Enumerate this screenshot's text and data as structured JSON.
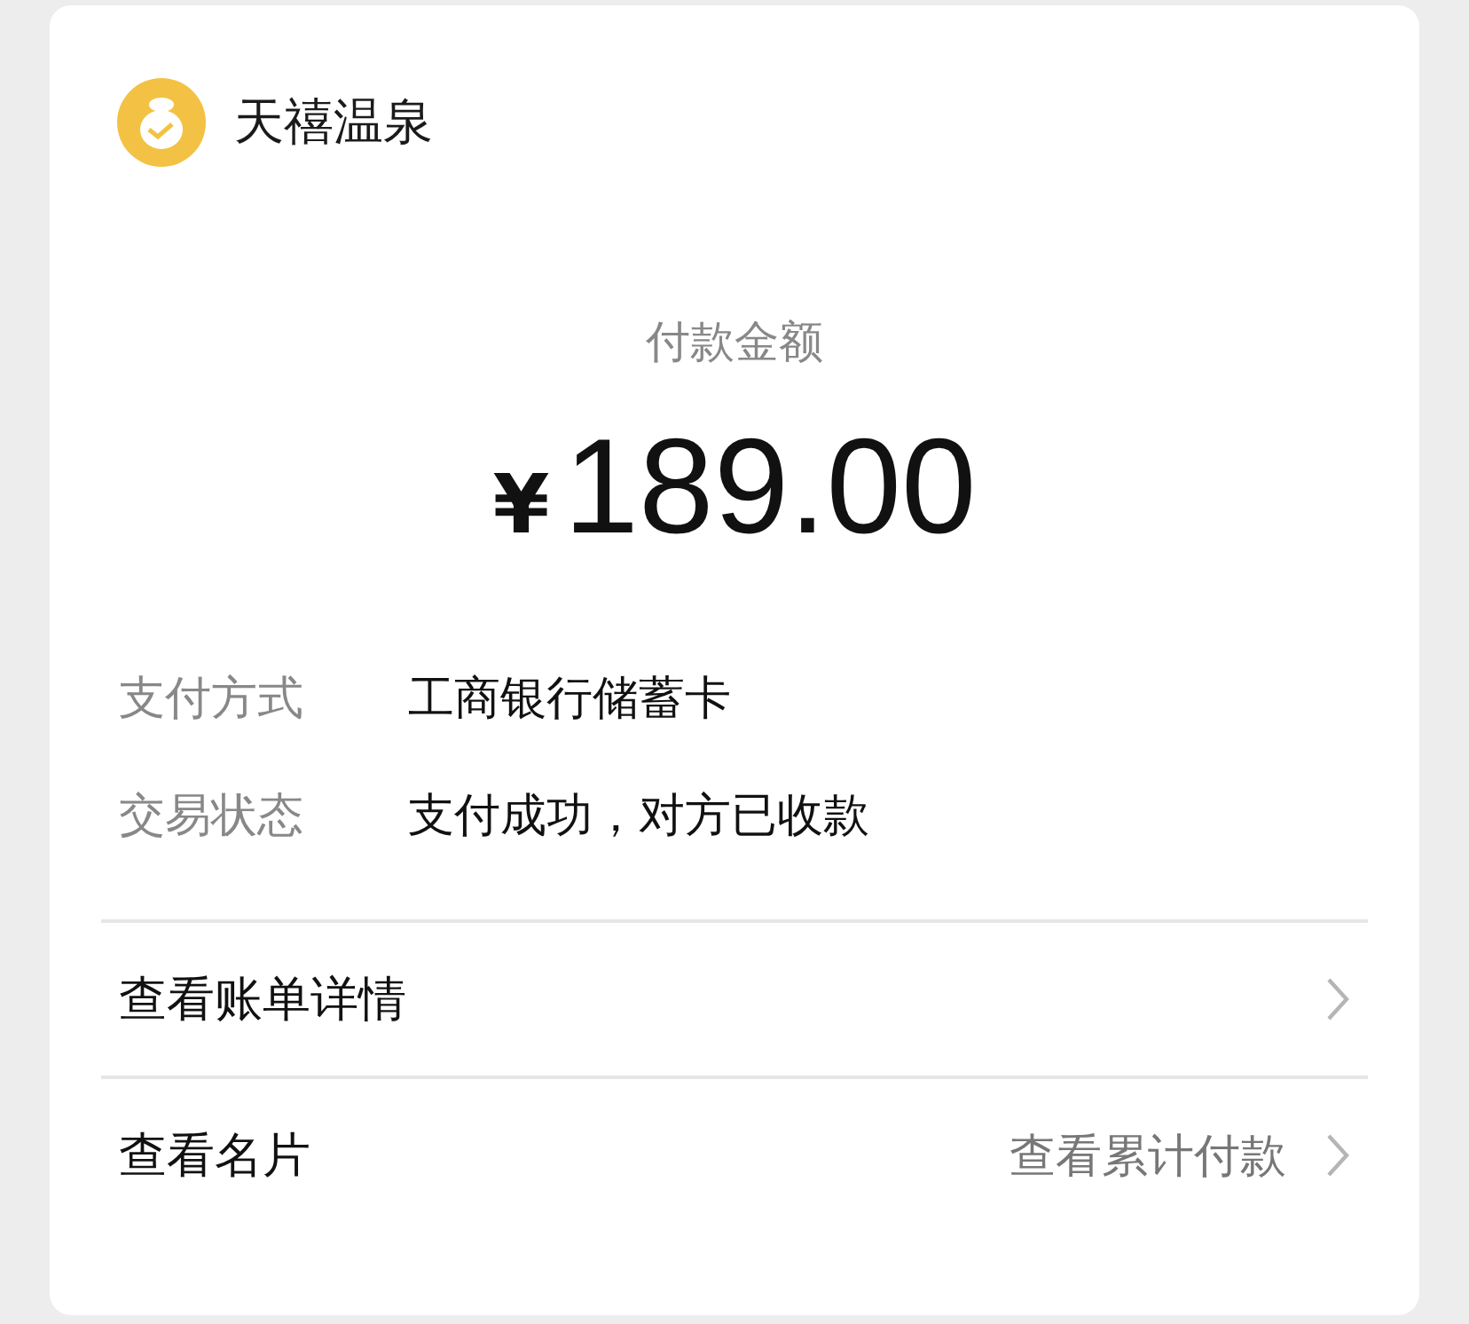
{
  "merchant": {
    "name": "天禧温泉"
  },
  "payment": {
    "label": "付款金额",
    "currency": "¥",
    "amount": "189.00"
  },
  "details": [
    {
      "label": "支付方式",
      "value": "工商银行储蓄卡"
    },
    {
      "label": "交易状态",
      "value": "支付成功，对方已收款"
    }
  ],
  "links": [
    {
      "label": "查看账单详情"
    },
    {
      "label": "查看名片",
      "extra": "查看累计付款"
    }
  ]
}
